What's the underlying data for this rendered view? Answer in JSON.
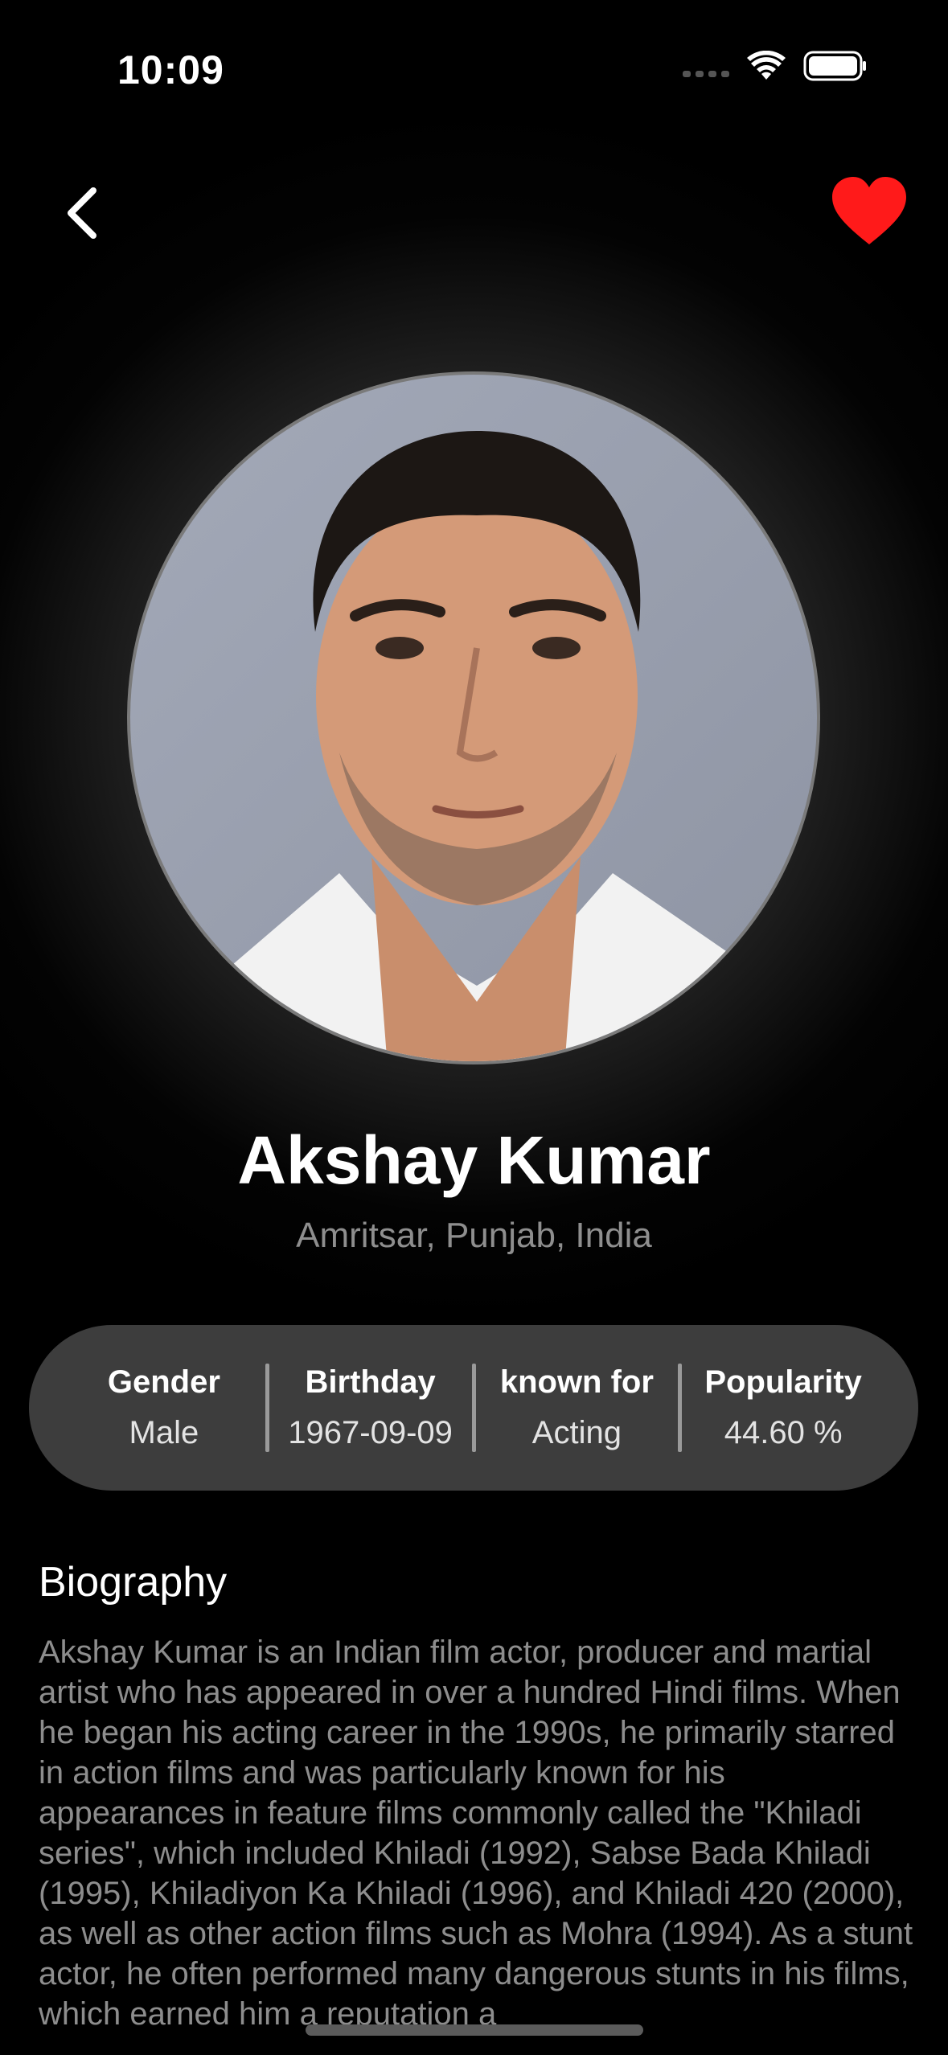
{
  "status_bar": {
    "time": "10:09"
  },
  "header": {
    "back_icon": "chevron-left-icon",
    "favorite_icon": "heart-icon",
    "favorite_color": "#ff1a1a"
  },
  "person": {
    "name": "Akshay Kumar",
    "place_of_birth": "Amritsar, Punjab, India"
  },
  "info": [
    {
      "label": "Gender",
      "value": "Male"
    },
    {
      "label": "Birthday",
      "value": "1967-09-09"
    },
    {
      "label": "known for",
      "value": "Acting"
    },
    {
      "label": "Popularity",
      "value": "44.60 %"
    }
  ],
  "biography": {
    "title": "Biography",
    "text": "Akshay Kumar is an Indian film actor, producer and martial artist who has appeared in over a hundred Hindi films. When he began his acting career in the 1990s, he primarily starred in action films and was particularly known for his appearances in feature films commonly called the \"Khiladi series\", which included Khiladi (1992), Sabse Bada Khiladi (1995), Khiladiyon Ka Khiladi (1996), and Khiladi 420 (2000), as well as other action films such as Mohra (1994). As a stunt actor, he often performed many dangerous stunts in his films, which earned him a reputation a"
  }
}
